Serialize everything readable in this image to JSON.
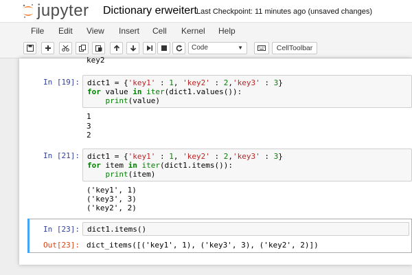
{
  "header": {
    "logo_text": "jupyter",
    "notebook_title": "Dictionary erweitert",
    "checkpoint": "Last Checkpoint: 11 minutes ago (unsaved changes)"
  },
  "menu": [
    "File",
    "Edit",
    "View",
    "Insert",
    "Cell",
    "Kernel",
    "Help"
  ],
  "toolbar": {
    "cell_type": "Code",
    "celltoolbar_label": "CellToolbar"
  },
  "colors": {
    "logo_orange": "#f37726",
    "prompt_in": "#303f9f",
    "prompt_out": "#d84315",
    "selected_cell": "#42a5f5",
    "keyword": "#008000",
    "string": "#ba2121"
  },
  "cells": {
    "prev_output": "key2",
    "cell19": {
      "prompt": "In [19]:",
      "lines": [
        "dict1 = {'key1' : 1, 'key2' : 2,'key3' : 3}",
        "for value in iter(dict1.values()):",
        "    print(value)"
      ],
      "output": [
        "1",
        "3",
        "2"
      ]
    },
    "cell21": {
      "prompt": "In [21]:",
      "lines": [
        "dict1 = {'key1' : 1, 'key2' : 2,'key3' : 3}",
        "for item in iter(dict1.items()):",
        "    print(item)"
      ],
      "output": [
        "('key1', 1)",
        "('key3', 3)",
        "('key2', 2)"
      ]
    },
    "cell23": {
      "prompt": "In [23]:",
      "code": "dict1.items()",
      "out_prompt": "Out[23]:",
      "output": "dict_items([('key1', 1), ('key3', 3), ('key2', 2)])"
    }
  }
}
